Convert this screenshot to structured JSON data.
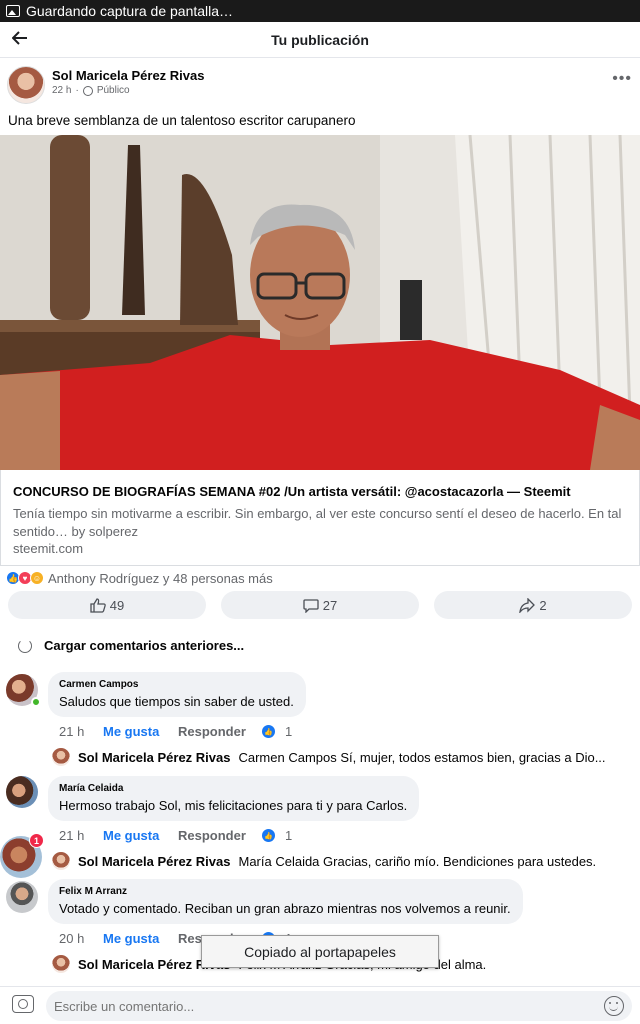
{
  "status_bar": {
    "text": "Guardando captura de pantalla…"
  },
  "header": {
    "title": "Tu publicación"
  },
  "post": {
    "author": "Sol Maricela Pérez Rivas",
    "time": "22 h",
    "privacy": "Público",
    "text": "Una breve semblanza de un talentoso escritor carupanero",
    "link": {
      "title": "CONCURSO DE BIOGRAFÍAS SEMANA #02 /Un artista versátil: @acostacazorla — Steemit",
      "description": "Tenía tiempo sin motivarme a escribir. Sin embargo, al ver este concurso sentí el deseo de hacerlo. En tal sentido… by solperez",
      "domain": "steemit.com"
    },
    "reactions_text": "Anthony Rodríguez y 48 personas más",
    "likes": "49",
    "comments": "27",
    "shares": "2"
  },
  "load_previous": "Cargar comentarios anteriores...",
  "comment_actions": {
    "like": "Me gusta",
    "reply": "Responder"
  },
  "comments": [
    {
      "name": "Carmen Campos",
      "text": "Saludos que tiempos sin saber de usted.",
      "time": "21 h",
      "like_count": "1",
      "reply": {
        "name": "Sol Maricela Pérez Rivas",
        "text": "Carmen Campos Sí, mujer, todos estamos bien, gracias a Dio..."
      }
    },
    {
      "name": "María Celaida",
      "text": "Hermoso trabajo Sol, mis felicitaciones para ti y para Carlos.",
      "time": "21 h",
      "like_count": "1",
      "badge": "1",
      "reply": {
        "name": "Sol Maricela Pérez Rivas",
        "text": "María Celaida Gracias, cariño mío. Bendiciones para ustedes."
      }
    },
    {
      "name": "Felix M Arranz",
      "text": "Votado y comentado. Reciban un gran abrazo mientras nos volvemos a reunir.",
      "time": "20 h",
      "like_count": "1",
      "reply": {
        "name": "Sol Maricela Pérez Rivas",
        "text": "Felix M Arranz Gracias, mi amigo del alma."
      }
    }
  ],
  "toast": "Copiado al portapapeles",
  "composer": {
    "placeholder": "Escribe un comentario..."
  }
}
